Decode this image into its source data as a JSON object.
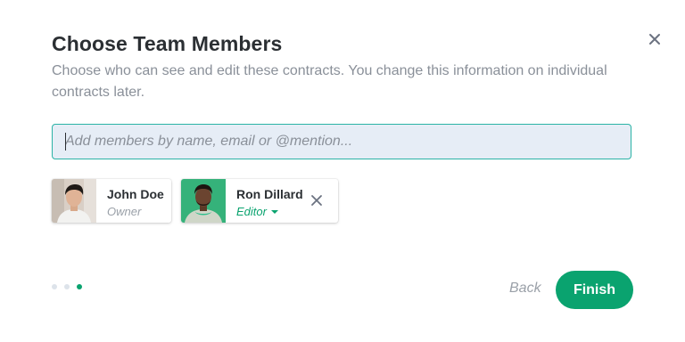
{
  "dialog": {
    "title": "Choose Team Members",
    "subtitle": "Choose who can see and edit these contracts. You change this information on individual contracts later.",
    "close_icon": "close-icon"
  },
  "search": {
    "placeholder": "Add members by name, email or @mention...",
    "value": ""
  },
  "members": [
    {
      "name": "John Doe",
      "role": "Owner",
      "role_editable": false,
      "avatar_bg": "#d9cfc6"
    },
    {
      "name": "Ron Dillard",
      "role": "Editor",
      "role_editable": true,
      "avatar_bg": "#35b27a",
      "remove_icon": "close-icon"
    }
  ],
  "pagination": {
    "total": 3,
    "active": 3
  },
  "footer": {
    "back_label": "Back",
    "finish_label": "Finish"
  },
  "colors": {
    "accent": "#0aa36f",
    "focus_border": "#2bb3a6",
    "input_bg": "#e6edf6",
    "muted_text": "#8a9099"
  }
}
